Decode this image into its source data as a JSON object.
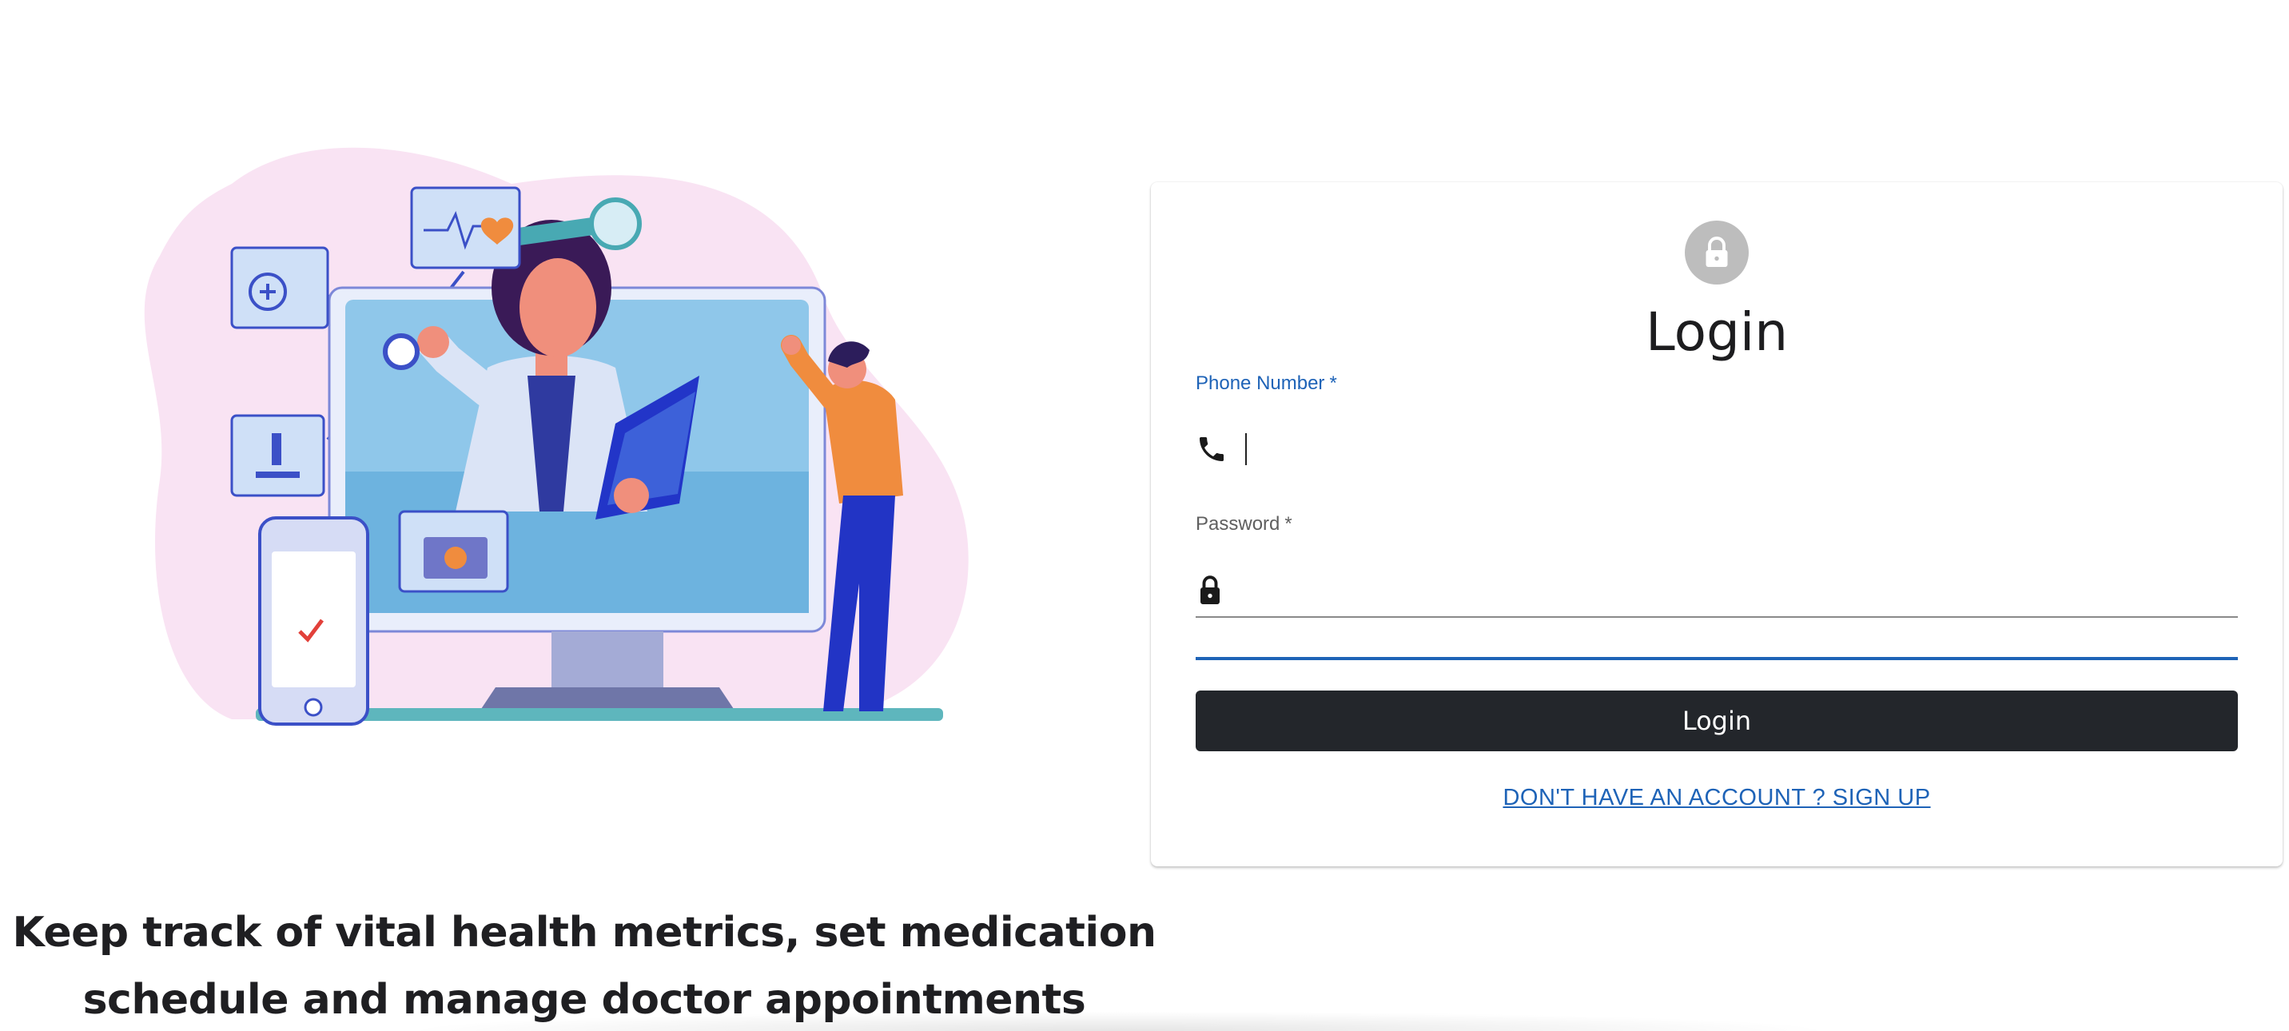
{
  "hero": {
    "tagline": "Keep track of vital health metrics, set medication schedule and manage doctor appointments"
  },
  "login_card": {
    "avatar_icon": "lock-icon",
    "title": "Login",
    "phone_field": {
      "label": "Phone Number",
      "required_mark": "*",
      "icon": "phone-icon",
      "value": "",
      "focused": true
    },
    "password_field": {
      "label": "Password",
      "required_mark": "*",
      "icon": "lock-icon",
      "value": ""
    },
    "submit_label": "Login",
    "signup_link": "DON'T HAVE AN ACCOUNT ? SIGN UP"
  },
  "colors": {
    "primary": "#1e63b7",
    "button": "#23262b",
    "avatar_bg": "#bdbdbd",
    "blob": "#f9e3f3"
  }
}
